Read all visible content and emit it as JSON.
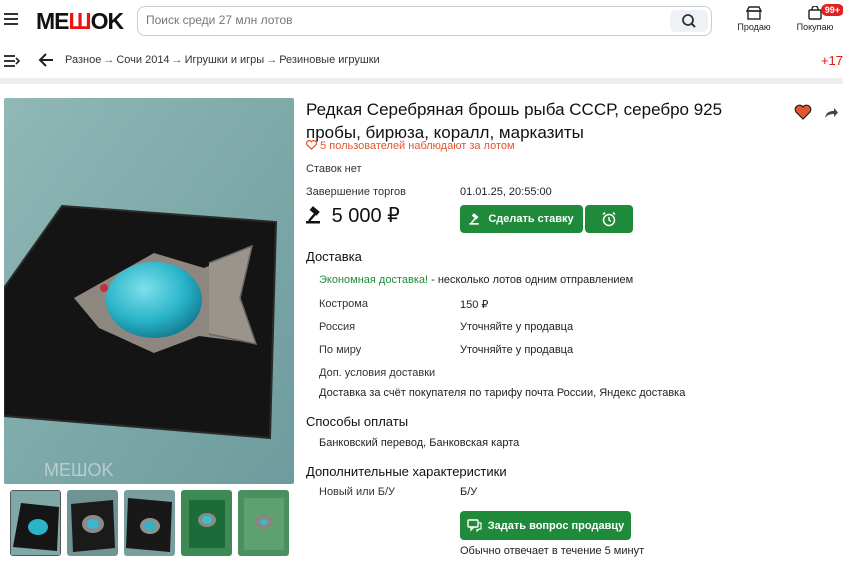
{
  "header": {
    "logo_left": "ME",
    "logo_mid": "Ш",
    "logo_right": "OK",
    "search_placeholder": "Поиск среди 27 млн лотов",
    "sell_label": "Продаю",
    "buy_label": "Покупаю",
    "buy_badge": "99+"
  },
  "breadcrumb": {
    "items": [
      "Разное",
      "Сочи 2014",
      "Игрушки и игры",
      "Резиновые игрушки"
    ],
    "separator": "→",
    "more_count": "+17"
  },
  "lot": {
    "title": "Редкая Серебряная брошь рыба СССР, серебро 925 пробы, бирюза, коралл, марказиты",
    "watchers": "5 пользователей наблюдают за лотом",
    "bids": "Ставок нет",
    "end_label": "Завершение торгов",
    "end_value": "01.01.25, 20:55:00",
    "price": "5 000 ₽",
    "bid_button": "Сделать ставку"
  },
  "delivery": {
    "heading": "Доставка",
    "economy_link": "Экономная доставка!",
    "economy_note": " - несколько лотов одним отправлением",
    "rows": [
      {
        "label": "Кострома",
        "value": "150 ₽"
      },
      {
        "label": "Россия",
        "value": "Уточняйте у продавца"
      },
      {
        "label": "По миру",
        "value": "Уточняйте у продавца"
      }
    ],
    "extra_label": "Доп. условия доставки",
    "extra_value": "Доставка за счёт покупателя по тарифу  почта России, Яндекс доставка"
  },
  "payment": {
    "heading": "Способы оплаты",
    "value": "Банковский перевод, Банковская карта"
  },
  "characteristics": {
    "heading": "Дополнительные характеристики",
    "label": "Новый или Б/У",
    "value": "Б/У"
  },
  "seller": {
    "ask_button": "Задать вопрос продавцу",
    "response_note": "Обычно отвечает в течение 5 минут"
  },
  "colors": {
    "brand_red": "#e11111",
    "action_green": "#1f8a3a",
    "watch_orange": "#e2552d"
  }
}
